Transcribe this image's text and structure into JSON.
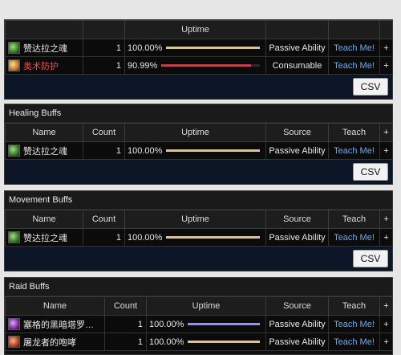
{
  "panel0": {
    "headers": {
      "uptime": "Uptime",
      "plus": "+"
    },
    "rows": [
      {
        "name": "赞达拉之魂",
        "count": "1",
        "uptime": "100.00%",
        "uptime_value": 1.0,
        "bar_color": "#d9c3a0",
        "source": "Passive Ability",
        "teach": "Teach Me!",
        "plus": "+",
        "icon": "green-spirit-icon"
      },
      {
        "name": "奥术防护",
        "count": "1",
        "uptime": "90.99%",
        "uptime_value": 0.9099,
        "bar_color": "#c0404a",
        "source": "Consumable",
        "teach": "Teach Me!",
        "plus": "+",
        "icon": "gold-potion-icon"
      }
    ],
    "csv": "CSV"
  },
  "healing": {
    "title": "Healing Buffs",
    "headers": {
      "name": "Name",
      "count": "Count",
      "uptime": "Uptime",
      "source": "Source",
      "teach": "Teach",
      "plus": "+"
    },
    "rows": [
      {
        "name": "赞达拉之魂",
        "count": "1",
        "uptime": "100.00%",
        "uptime_value": 1.0,
        "bar_color": "#d9c3a0",
        "source": "Passive Ability",
        "teach": "Teach Me!",
        "plus": "+",
        "icon": "green-spirit-icon"
      }
    ],
    "csv": "CSV"
  },
  "movement": {
    "title": "Movement Buffs",
    "headers": {
      "name": "Name",
      "count": "Count",
      "uptime": "Uptime",
      "source": "Source",
      "teach": "Teach",
      "plus": "+"
    },
    "rows": [
      {
        "name": "赞达拉之魂",
        "count": "1",
        "uptime": "100.00%",
        "uptime_value": 1.0,
        "bar_color": "#d9c3a0",
        "source": "Passive Ability",
        "teach": "Teach Me!",
        "plus": "+",
        "icon": "green-spirit-icon"
      }
    ],
    "csv": "CSV"
  },
  "raid": {
    "title": "Raid Buffs",
    "headers": {
      "name": "Name",
      "count": "Count",
      "uptime": "Uptime",
      "source": "Source",
      "teach": "Teach",
      "plus": "+"
    },
    "rows": [
      {
        "name": "塞格的黑暗塔罗…",
        "count": "1",
        "uptime": "100.00%",
        "uptime_value": 1.0,
        "bar_color": "#9a90d8",
        "source": "Passive Ability",
        "teach": "Teach Me!",
        "plus": "+",
        "icon": "purple-tarot-icon"
      },
      {
        "name": "屠龙者的咆哮",
        "count": "1",
        "uptime": "100.00%",
        "uptime_value": 1.0,
        "bar_color": "#d9c3a0",
        "source": "Passive Ability",
        "teach": "Teach Me!",
        "plus": "+",
        "icon": "red-roar-icon"
      }
    ]
  }
}
